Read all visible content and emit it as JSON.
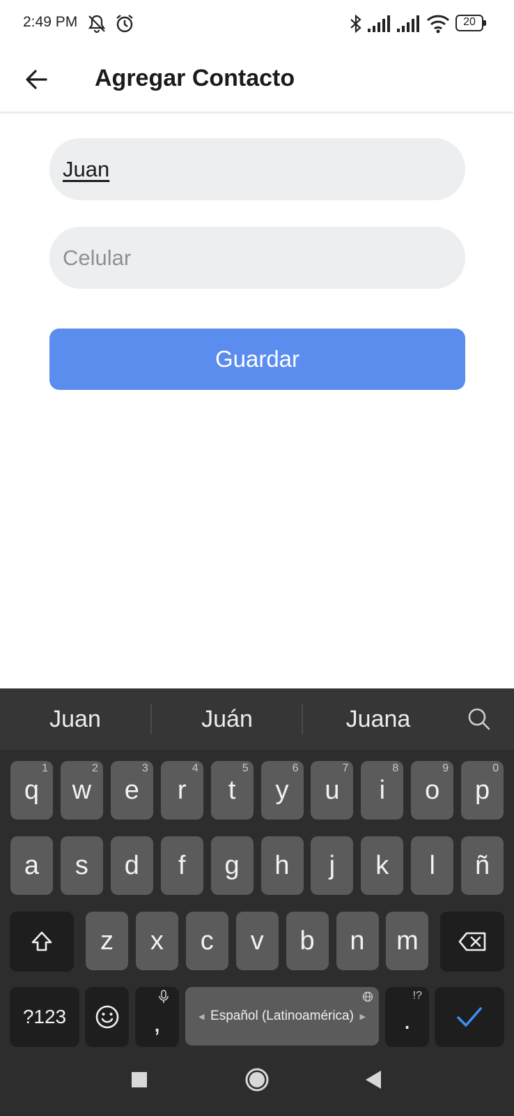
{
  "status_bar": {
    "time": "2:49 PM",
    "battery_level": "20",
    "icons": [
      "notifications-muted-icon",
      "alarm-icon",
      "bluetooth-icon",
      "signal-icon",
      "signal-icon",
      "wifi-icon",
      "battery-icon"
    ]
  },
  "app_bar": {
    "title": "Agregar Contacto",
    "back_icon": "back-arrow-icon"
  },
  "form": {
    "name_value": "Juan",
    "name_placeholder": "",
    "phone_value": "",
    "phone_placeholder": "Celular",
    "save_label": "Guardar"
  },
  "keyboard": {
    "suggestions": [
      "Juan",
      "Juán",
      "Juana"
    ],
    "row1": [
      {
        "k": "q",
        "h": "1"
      },
      {
        "k": "w",
        "h": "2"
      },
      {
        "k": "e",
        "h": "3"
      },
      {
        "k": "r",
        "h": "4"
      },
      {
        "k": "t",
        "h": "5"
      },
      {
        "k": "y",
        "h": "6"
      },
      {
        "k": "u",
        "h": "7"
      },
      {
        "k": "i",
        "h": "8"
      },
      {
        "k": "o",
        "h": "9"
      },
      {
        "k": "p",
        "h": "0"
      }
    ],
    "row2": [
      "a",
      "s",
      "d",
      "f",
      "g",
      "h",
      "j",
      "k",
      "l",
      "ñ"
    ],
    "row3": [
      "z",
      "x",
      "c",
      "v",
      "b",
      "n",
      "m"
    ],
    "symbols_label": "?123",
    "comma_label": ",",
    "period_label": ".",
    "period_hint": "!?",
    "space_label": "Español (Latinoamérica)",
    "colors": {
      "accent": "#5b8def",
      "key": "#5b5b5b",
      "key_dark": "#1e1e1e",
      "background": "#2d2d2d",
      "enter_check": "#3d8ef0"
    }
  }
}
